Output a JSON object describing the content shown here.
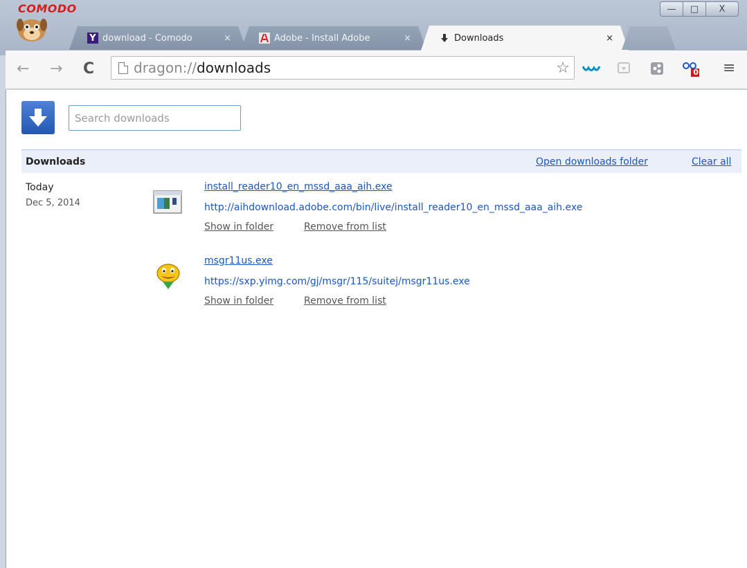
{
  "window": {
    "brand": "COMODO",
    "minimize_glyph": "—",
    "maximize_glyph": "□",
    "close_glyph": "X"
  },
  "tabs": [
    {
      "title": "download - Comodo",
      "icon": "yahoo-icon",
      "favicon_text": "Y",
      "close": "×"
    },
    {
      "title": "Adobe - Install Adobe",
      "icon": "adobe-icon",
      "close": "×"
    },
    {
      "title": "Downloads",
      "icon": "download-arrow-icon",
      "close": "×"
    }
  ],
  "toolbar": {
    "back": "←",
    "forward": "→",
    "reload": "C",
    "url_scheme": "dragon://",
    "url_host": "downloads",
    "star": "☆",
    "badge_count": "0",
    "menu": "≡"
  },
  "page": {
    "search_placeholder": "Search downloads",
    "header_title": "Downloads",
    "open_folder": "Open downloads folder",
    "clear_all": "Clear all",
    "date_label": "Today",
    "date_value": "Dec 5, 2014"
  },
  "downloads": [
    {
      "name": "install_reader10_en_mssd_aaa_aih.exe",
      "url": "http://aihdownload.adobe.com/bin/live/install_reader10_en_mssd_aaa_aih.exe",
      "show_in_folder": "Show in folder",
      "remove": "Remove from list"
    },
    {
      "name": "msgr11us.exe",
      "url": "https://sxp.yimg.com/gj/msgr/115/suitej/msgr11us.exe",
      "show_in_folder": "Show in folder",
      "remove": "Remove from list"
    }
  ],
  "colors": {
    "link": "#1a55c4",
    "header_bg": "#ebeff9",
    "brand": "#d21f1f"
  }
}
